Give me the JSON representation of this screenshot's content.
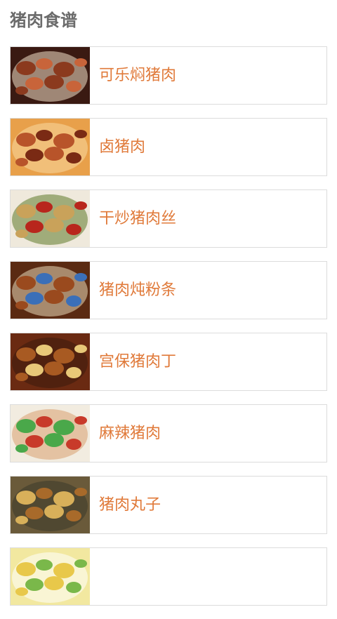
{
  "header": {
    "title": "猪肉食谱"
  },
  "recipes": [
    {
      "name": "可乐焖猪肉",
      "thumb_icon": "braised-pork-photo",
      "palette": [
        "#3a1a12",
        "#8b3a1e",
        "#c8643a",
        "#f2e2c8"
      ]
    },
    {
      "name": "卤猪肉",
      "thumb_icon": "marinated-pork-photo",
      "palette": [
        "#e8a04a",
        "#b8542a",
        "#7a2a14",
        "#f7d9a0"
      ]
    },
    {
      "name": "干炒猪肉丝",
      "thumb_icon": "shredded-pork-photo",
      "palette": [
        "#efe9dc",
        "#c9a25a",
        "#b8261c",
        "#5e7a2a"
      ]
    },
    {
      "name": "猪肉炖粉条",
      "thumb_icon": "pork-noodle-stew-photo",
      "palette": [
        "#5a2a12",
        "#9a4a1e",
        "#3b6fb8",
        "#e9d9b8"
      ]
    },
    {
      "name": "宫保猪肉丁",
      "thumb_icon": "kungpao-pork-photo",
      "palette": [
        "#6a2a12",
        "#a85a22",
        "#e8c878",
        "#3a1a0c"
      ]
    },
    {
      "name": "麻辣猪肉",
      "thumb_icon": "spicy-pork-photo",
      "palette": [
        "#f2ece0",
        "#4aa84a",
        "#c83a2a",
        "#d8a070"
      ]
    },
    {
      "name": "猪肉丸子",
      "thumb_icon": "pork-meatball-photo",
      "palette": [
        "#6a5a3a",
        "#d8b05a",
        "#a86a2a",
        "#3a3a2a"
      ]
    },
    {
      "name": "",
      "thumb_icon": "dish-photo",
      "palette": [
        "#f2e8a0",
        "#e8c84a",
        "#7ab84a",
        "#ffffff"
      ]
    }
  ]
}
